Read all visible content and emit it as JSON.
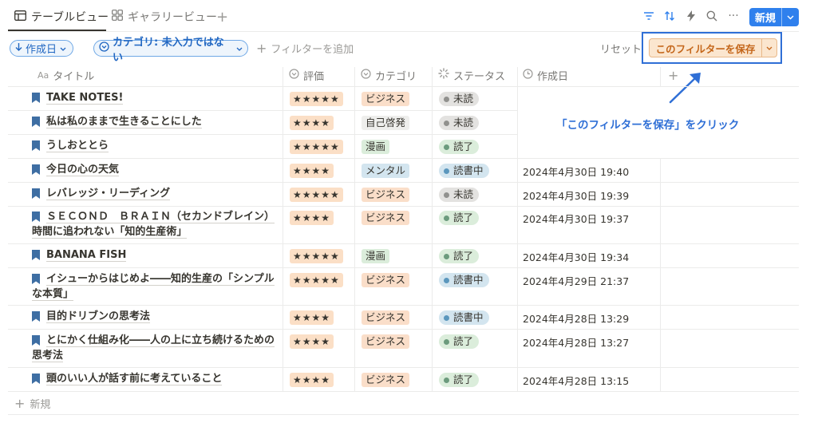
{
  "tabs": [
    {
      "label": "テーブルビュー",
      "icon": "table-icon"
    },
    {
      "label": "ギャラリービュー",
      "icon": "gallery-icon"
    }
  ],
  "toolbar": {
    "new_label": "新規"
  },
  "filters": {
    "date_chip": "作成日",
    "category_chip": "カテゴリ: 未入力ではない",
    "add_filter": "フィルターを追加",
    "reset": "リセット",
    "save": "このフィルターを保存"
  },
  "columns": {
    "title": "タイトル",
    "title_prefix": "Aa",
    "rating": "評価",
    "category": "カテゴリ",
    "status": "ステータス",
    "created": "作成日"
  },
  "annotation": "「このフィルターを保存」をクリック",
  "colors": {
    "accent": "#2f80ed",
    "highlight": "#2f6fd6",
    "save_bg": "#fbe6cf",
    "save_text": "#c4661a",
    "stars_bg": "#fbdfc6"
  },
  "rows": [
    {
      "title": "TAKE NOTES!",
      "rating": "★★★★★",
      "category": "ビジネス",
      "status": "未読",
      "created": ""
    },
    {
      "title": "私は私のままで生きることにした",
      "rating": "★★★★",
      "category": "自己啓発",
      "status": "未読",
      "created": ""
    },
    {
      "title": "うしおととら",
      "rating": "★★★★★",
      "category": "漫画",
      "status": "読了",
      "created": ""
    },
    {
      "title": "今日の心の天気",
      "rating": "★★★★",
      "category": "メンタル",
      "status": "読書中",
      "created": "2024年4月30日 19:40"
    },
    {
      "title": "レバレッジ・リーディング",
      "rating": "★★★★★",
      "category": "ビジネス",
      "status": "未読",
      "created": "2024年4月30日 19:39"
    },
    {
      "title_line1": "ＳＥＣＯＮＤ　ＢＲＡＩＮ（セカンドブレイン）",
      "title_line2": "時間に追われない「知的生産術」",
      "rating": "★★★★",
      "category": "ビジネス",
      "status": "読了",
      "created": "2024年4月30日 19:37"
    },
    {
      "title": "BANANA FISH",
      "rating": "★★★★★",
      "category": "漫画",
      "status": "読了",
      "created": "2024年4月30日 19:34"
    },
    {
      "title_line1": "イシューからはじめよ――知的生産の「シンプル",
      "title_line2": "な本質」",
      "rating": "★★★★★",
      "category": "ビジネス",
      "status": "読書中",
      "created": "2024年4月29日 21:37"
    },
    {
      "title": "目的ドリブンの思考法",
      "rating": "★★★★",
      "category": "ビジネス",
      "status": "読書中",
      "created": "2024年4月28日 13:29"
    },
    {
      "title_line1": "とにかく仕組み化――人の上に立ち続けるための",
      "title_line2": "思考法",
      "rating": "★★★★",
      "category": "ビジネス",
      "status": "読了",
      "created": "2024年4月28日 13:27"
    },
    {
      "title": "頭のいい人が話す前に考えていること",
      "rating": "★★★★",
      "category": "ビジネス",
      "status": "読了",
      "created": "2024年4月28日 13:15"
    }
  ],
  "new_row": "新規"
}
